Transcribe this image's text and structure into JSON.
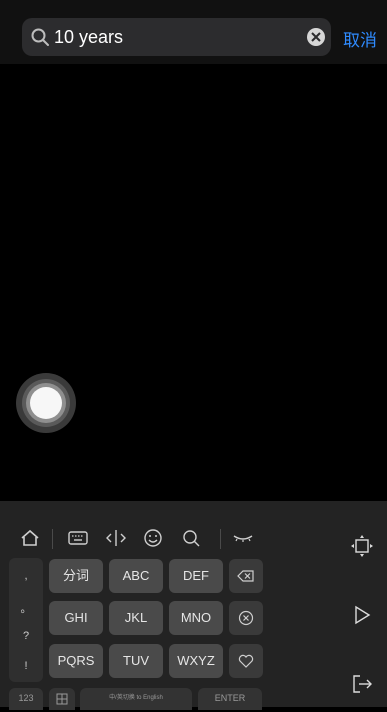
{
  "search": {
    "value": "10 years",
    "cancel_label": "取消"
  },
  "keyboard": {
    "punctuation": [
      ",",
      "。",
      "?",
      "!"
    ],
    "rows": [
      [
        "分词",
        "ABC",
        "DEF"
      ],
      [
        "GHI",
        "JKL",
        "MNO"
      ],
      [
        "PQRS",
        "TUV",
        "WXYZ"
      ]
    ],
    "bottom": {
      "num_label": "123",
      "space_label": "中/英切换 to English",
      "enter_label": "ENTER"
    }
  },
  "colors": {
    "accent": "#2f8bff",
    "keyboard_bg": "#232323",
    "key_bg": "#4a4a4a"
  }
}
